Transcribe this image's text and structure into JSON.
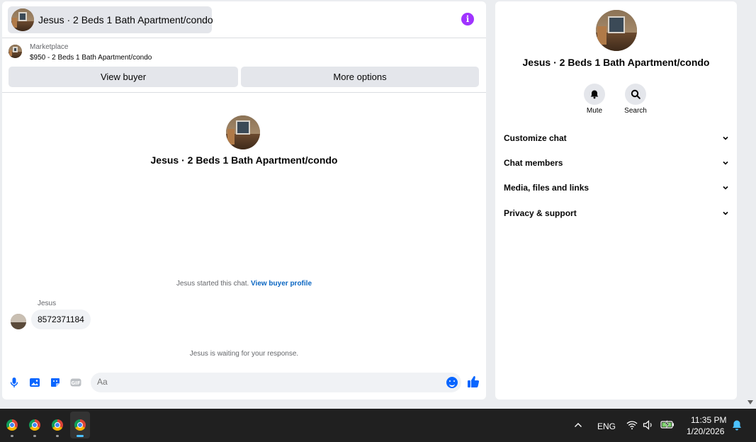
{
  "chat": {
    "title": "Jesus · 2 Beds 1 Bath Apartment/condo",
    "marketplace_label": "Marketplace",
    "listing": "$950 - 2 Beds 1 Bath Apartment/condo",
    "view_buyer": "View buyer",
    "more_options": "More options",
    "center_name": "Jesus · 2 Beds 1 Bath Apartment/condo",
    "started_text": "Jesus started this chat.",
    "view_buyer_profile": "View buyer profile",
    "sender": "Jesus",
    "message": "8572371184",
    "waiting": "Jesus is waiting for your response.",
    "composer_placeholder": "Aa"
  },
  "details": {
    "name": "Jesus · 2 Beds 1 Bath Apartment/condo",
    "mute_label": "Mute",
    "search_label": "Search",
    "sections": [
      "Customize chat",
      "Chat members",
      "Media, files and links",
      "Privacy & support"
    ]
  },
  "taskbar": {
    "language": "ENG",
    "time": "11:35 PM",
    "date": "1/20/2026"
  },
  "colors": {
    "accent": "#0866ff",
    "info": "#a033ff",
    "link": "#0a66c2"
  }
}
